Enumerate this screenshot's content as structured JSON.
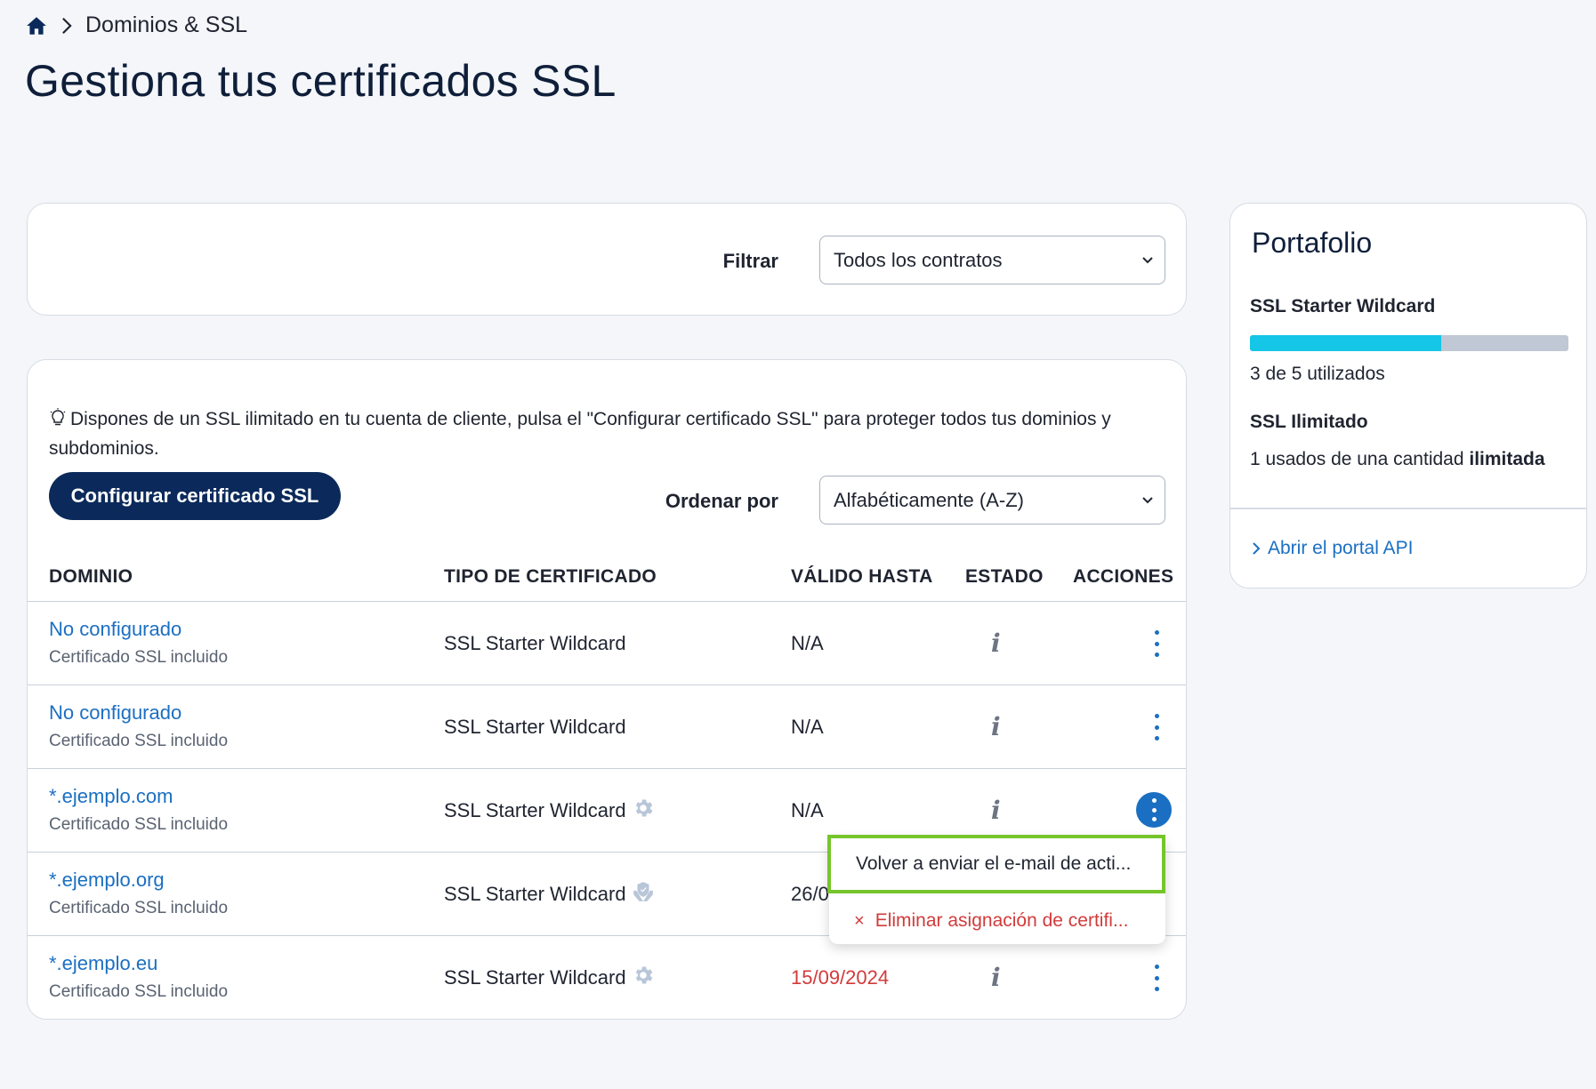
{
  "breadcrumb": {
    "home_icon": "home-icon",
    "current": "Dominios & SSL"
  },
  "page_title": "Gestiona tus certificados SSL",
  "filter": {
    "label": "Filtrar",
    "selected": "Todos los contratos"
  },
  "tip": {
    "icon": "lightbulb-icon",
    "text": "Dispones de un SSL ilimitado en tu cuenta de cliente, pulsa el \"Configurar certificado SSL\" para proteger todos tus dominios y subdominios."
  },
  "config_button": "Configurar certificado SSL",
  "order": {
    "label": "Ordenar por",
    "selected": "Alfabéticamente (A-Z)"
  },
  "table": {
    "headers": {
      "domain": "DOMINIO",
      "type": "TIPO DE CERTIFICADO",
      "valid": "VÁLIDO HASTA",
      "status": "ESTADO",
      "actions": "ACCIONES"
    },
    "rows": [
      {
        "domain": "No configurado",
        "sub": "Certificado SSL incluido",
        "type": "SSL Starter Wildcard",
        "type_icon": "",
        "valid": "N/A",
        "status": "i"
      },
      {
        "domain": "No configurado",
        "sub": "Certificado SSL incluido",
        "type": "SSL Starter Wildcard",
        "type_icon": "",
        "valid": "N/A",
        "status": "i"
      },
      {
        "domain": "*.ejemplo.com",
        "sub": "Certificado SSL incluido",
        "type": "SSL Starter Wildcard",
        "type_icon": "gear-icon",
        "valid": "N/A",
        "status": "i"
      },
      {
        "domain": "*.ejemplo.org",
        "sub": "Certificado SSL incluido",
        "type": "SSL Starter Wildcard",
        "type_icon": "shield-hand-icon",
        "valid": "26/0",
        "status": ""
      },
      {
        "domain": "*.ejemplo.eu",
        "sub": "Certificado SSL incluido",
        "type": "SSL Starter Wildcard",
        "type_icon": "gear-icon",
        "valid": "15/09/2024",
        "status": "i"
      }
    ]
  },
  "action_menu": {
    "item1": "Volver a enviar el e-mail de acti...",
    "item2": "Eliminar asignación de certifi...",
    "item2_icon": "×"
  },
  "portfolio": {
    "title": "Portafolio",
    "ssl_wildcard_label": "SSL Starter Wildcard",
    "ssl_wildcard_used": 3,
    "ssl_wildcard_total": 5,
    "ssl_wildcard_text": "3 de 5 utilizados",
    "ssl_unlimited_label": "SSL Ilimitado",
    "ssl_unlimited_text": "1 usados de una cantidad",
    "ssl_unlimited_bold": "ilimitada",
    "api_link": "Abrir el portal API"
  },
  "colors": {
    "accent": "#1b6fc2",
    "navy": "#0b2a5b",
    "progress": "#15c6e6",
    "danger": "#d23b3b",
    "highlight": "#76c52b"
  }
}
